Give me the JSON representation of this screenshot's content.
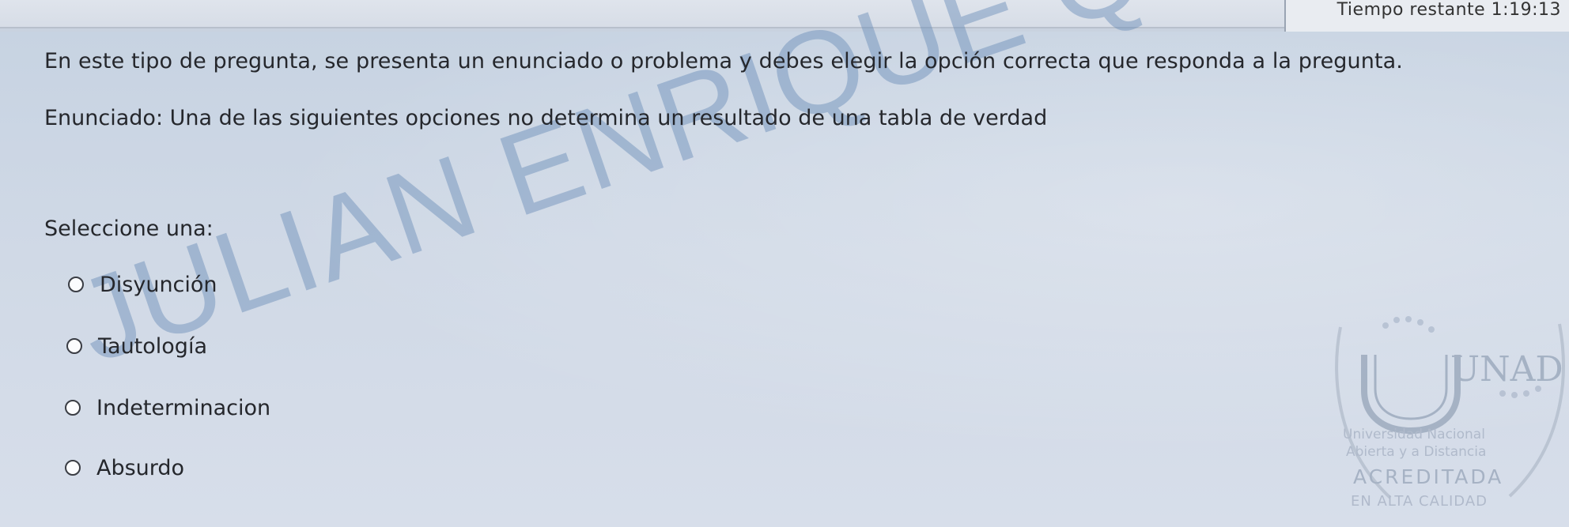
{
  "topbar": {
    "timer_text": "Tiempo restante 1:19:13"
  },
  "question": {
    "instruction": "En este tipo de pregunta, se presenta un enunciado o problema y debes elegir la opción correcta que responda a la pregunta.",
    "statement": "Enunciado: Una de las siguientes opciones no determina un resultado de una tabla de verdad",
    "prompt": "Seleccione una:",
    "options": [
      {
        "label": "Disyunción"
      },
      {
        "label": "Tautología"
      },
      {
        "label": "Indeterminacion"
      },
      {
        "label": "Absurdo"
      }
    ]
  },
  "watermark": {
    "text": "JULIAN ENRIQUE QUINONEZ"
  },
  "logo": {
    "brand_mark": "UNAD",
    "subtitle_line_1": "Universidad Nacional",
    "subtitle_line_2": "Abierta y a Distancia",
    "accreditation_text": "ACREDITADA",
    "accreditation_subtext": "EN ALTA CALIDAD"
  },
  "colors": {
    "background": "#cfd6e2",
    "text": "#25272c",
    "watermark": "#688bb6",
    "logo": "#8fa0b8"
  }
}
